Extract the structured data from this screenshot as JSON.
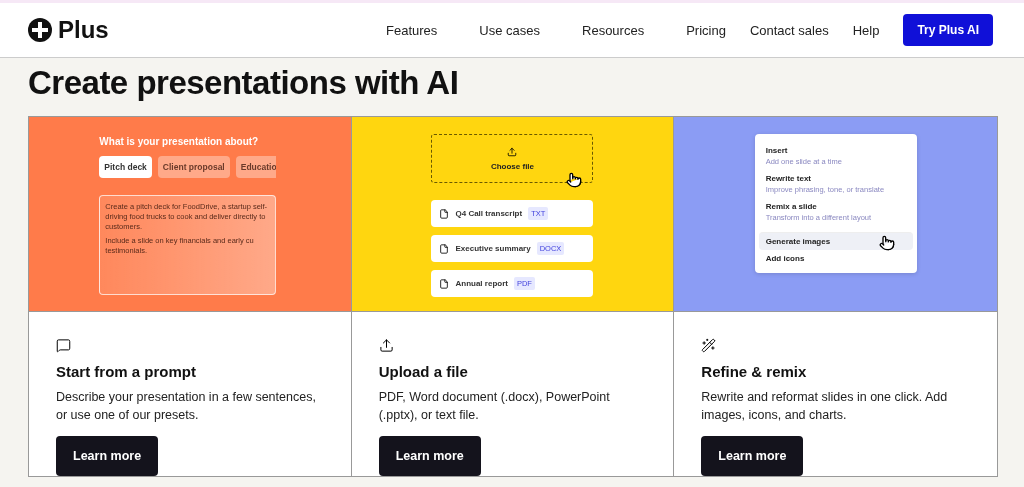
{
  "header": {
    "logo": "Plus",
    "nav": [
      "Features",
      "Use cases",
      "Resources",
      "Pricing",
      "Contact sales",
      "Help"
    ],
    "cta": "Try Plus AI"
  },
  "title": "Create presentations with AI",
  "cards": [
    {
      "kind": "prompt",
      "color": "#ff7b4a",
      "heading": "Start from a prompt",
      "text": "Describe your presentation in a few sentences, or use one of our presets.",
      "button": "Learn more",
      "question": "What is your presentation about?",
      "chips": [
        {
          "label": "Pitch deck",
          "selected": true
        },
        {
          "label": "Client proposal",
          "selected": false
        },
        {
          "label": "Educatio",
          "selected": false
        }
      ],
      "prompt": [
        "Create a pitch deck for FoodDrive, a startup self-driving food trucks to cook and deliver directly to customers.",
        "Include a slide on key financials and early cu testimonials."
      ]
    },
    {
      "kind": "upload",
      "color": "#ffd60f",
      "heading": "Upload a file",
      "text": "PDF, Word document (.docx), PowerPoint (.pptx), or text file.",
      "button": "Learn more",
      "drop": "Choose file",
      "files": [
        {
          "name": "Q4 Call transcript",
          "type": "TXT"
        },
        {
          "name": "Executive summary",
          "type": "DOCX"
        },
        {
          "name": "Annual report",
          "type": "PDF"
        }
      ]
    },
    {
      "kind": "remix",
      "color": "#8b9cf4",
      "heading": "Refine & remix",
      "text": "Rewrite and reformat slides in one click. Add images, icons, and charts.",
      "button": "Learn more",
      "menu": [
        {
          "label": "Insert",
          "hint": "Add one slide at a time",
          "selected": false
        },
        {
          "label": "Rewrite text",
          "hint": "Improve phrasing, tone, or translate",
          "selected": false
        },
        {
          "label": "Remix a slide",
          "hint": "Transform into a different layout",
          "selected": false
        },
        {
          "label": "Generate images",
          "selected": true
        },
        {
          "label": "Add icons",
          "selected": false
        }
      ]
    }
  ]
}
